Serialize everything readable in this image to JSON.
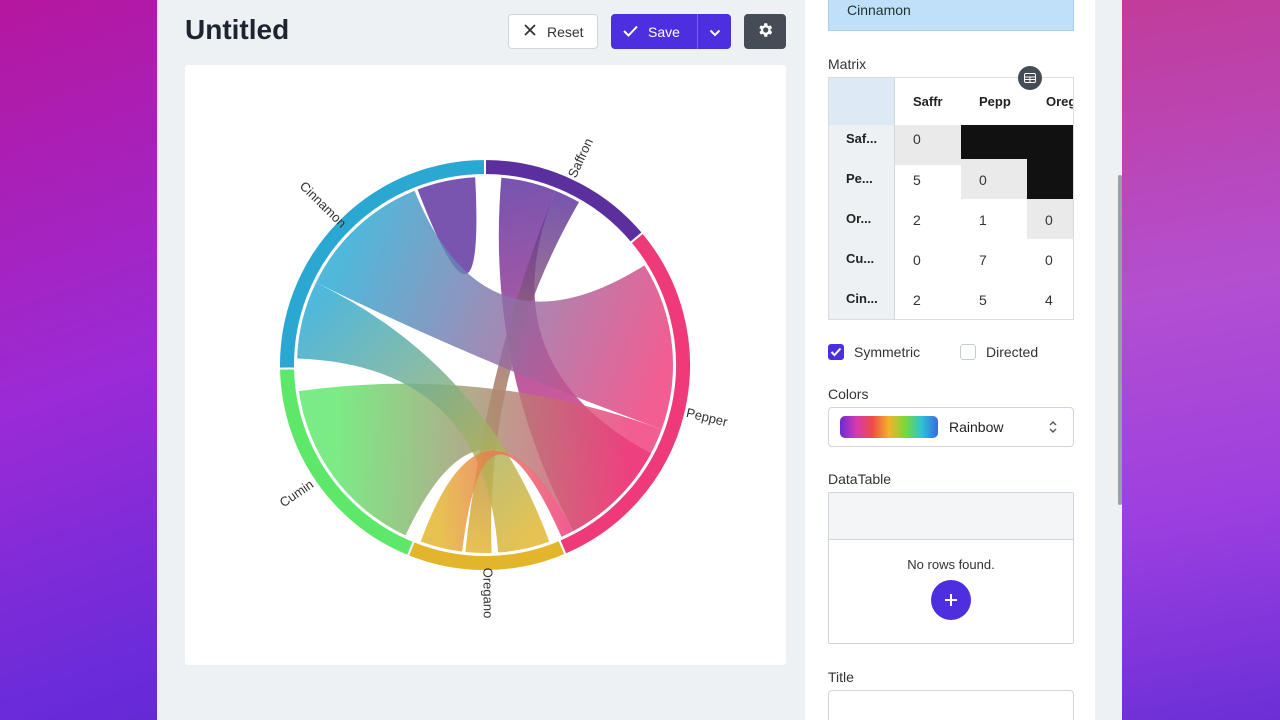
{
  "header": {
    "title": "Untitled",
    "reset_label": "Reset",
    "save_label": "Save"
  },
  "chord": {
    "groups": [
      "Saffron",
      "Pepper",
      "Oregano",
      "Cumin",
      "Cinnamon"
    ],
    "colors": {
      "Saffron": "#5b2f9e",
      "Pepper": "#ef3a7a",
      "Oregano": "#e3b52a",
      "Cumin": "#5ee86a",
      "Cinnamon": "#2aa8d2"
    }
  },
  "sidebar": {
    "selected_value": "Cinnamon",
    "matrix_label": "Matrix",
    "matrix": {
      "columns": [
        "Saffr",
        "Pepp",
        "Oreg"
      ],
      "rows": [
        {
          "label": "Saf...",
          "values": [
            "0",
            "",
            ""
          ]
        },
        {
          "label": "Pe...",
          "values": [
            "5",
            "0",
            ""
          ]
        },
        {
          "label": "Or...",
          "values": [
            "2",
            "1",
            "0"
          ]
        },
        {
          "label": "Cu...",
          "values": [
            "0",
            "7",
            "0"
          ]
        },
        {
          "label": "Cin...",
          "values": [
            "2",
            "5",
            "4"
          ]
        }
      ]
    },
    "symmetric_label": "Symmetric",
    "symmetric_checked": true,
    "directed_label": "Directed",
    "directed_checked": false,
    "colors_label": "Colors",
    "colors_value": "Rainbow",
    "datatable_label": "DataTable",
    "no_rows": "No rows found.",
    "title_label": "Title"
  }
}
